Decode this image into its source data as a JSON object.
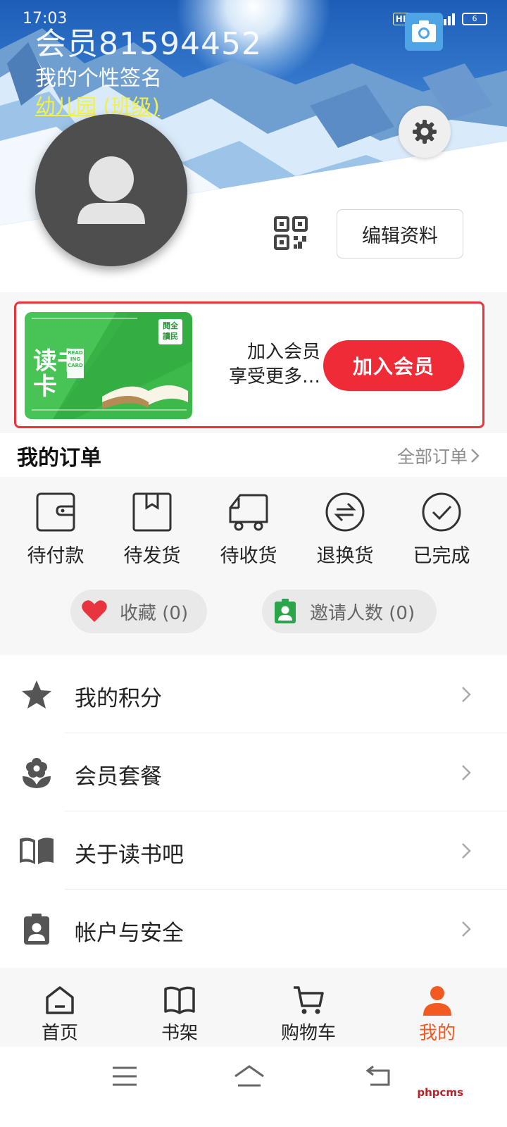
{
  "status_bar": {
    "time": "17:03",
    "network": "HD",
    "signal": "5G",
    "battery": "6"
  },
  "profile": {
    "member_name": "会员81594452",
    "signature": "我的个性签名",
    "school": "幼儿园 (班级)",
    "edit_label": "编辑资料"
  },
  "promo": {
    "card_title_top": "读书",
    "card_title_bottom": "卡",
    "card_badge": "READ\nING\nCARD",
    "card_seal": "閱全讀民",
    "text_line1": "加入会员",
    "text_line2": "享受更多…",
    "button_label": "加入会员"
  },
  "orders": {
    "title": "我的订单",
    "all_label": "全部订单",
    "items": [
      {
        "label": "待付款",
        "icon": "wallet-icon"
      },
      {
        "label": "待发货",
        "icon": "package-icon"
      },
      {
        "label": "待收货",
        "icon": "truck-icon"
      },
      {
        "label": "退换货",
        "icon": "exchange-icon"
      },
      {
        "label": "已完成",
        "icon": "check-circle-icon"
      }
    ],
    "favorites_label": "收藏 (0)",
    "invites_label": "邀请人数 (0)"
  },
  "menu": [
    {
      "label": "我的积分",
      "icon": "star-icon"
    },
    {
      "label": "会员套餐",
      "icon": "flower-icon"
    },
    {
      "label": "关于读书吧",
      "icon": "book-icon"
    },
    {
      "label": "帐户与安全",
      "icon": "id-badge-icon"
    }
  ],
  "tabs": [
    {
      "label": "首页",
      "icon": "home-icon",
      "active": false
    },
    {
      "label": "书架",
      "icon": "bookshelf-icon",
      "active": false
    },
    {
      "label": "购物车",
      "icon": "cart-icon",
      "active": false
    },
    {
      "label": "我的",
      "icon": "user-icon",
      "active": true
    }
  ],
  "watermark": "phpcms",
  "colors": {
    "accent": "#ee2b37",
    "active_tab": "#f25a22",
    "school_text": "#f3f046",
    "card_green": "#3db84a"
  }
}
